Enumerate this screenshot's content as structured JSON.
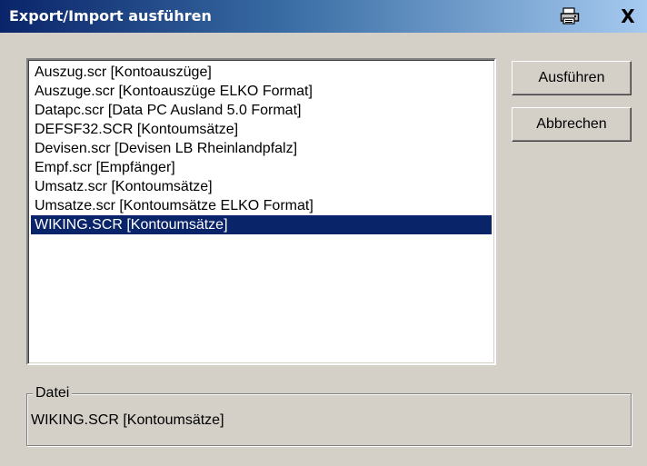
{
  "window": {
    "title": "Export/Import ausführen"
  },
  "title_buttons": {
    "print_icon": "printer-icon",
    "close_label": "X"
  },
  "list": {
    "items": [
      "Auszug.scr [Kontoauszüge]",
      "Auszuge.scr [Kontoauszüge ELKO Format]",
      "Datapc.scr [Data PC Ausland 5.0 Format]",
      "DEFSF32.SCR [Kontoumsätze]",
      "Devisen.scr [Devisen LB Rheinlandpfalz]",
      "Empf.scr [Empfänger]",
      "Umsatz.scr [Kontoumsätze]",
      "Umsatze.scr [Kontoumsätze ELKO Format]",
      "WIKING.SCR [Kontoumsätze]"
    ],
    "selected_index": 8
  },
  "buttons": {
    "run_label": "Ausführen",
    "cancel_label": "Abbrechen"
  },
  "file_group": {
    "legend": "Datei",
    "value": "WIKING.SCR [Kontoumsätze]"
  },
  "colors": {
    "selection": "#0a246a",
    "dialog_face": "#d4d0c8",
    "titlebar_start": "#0a246a",
    "titlebar_end": "#a6caf0"
  }
}
